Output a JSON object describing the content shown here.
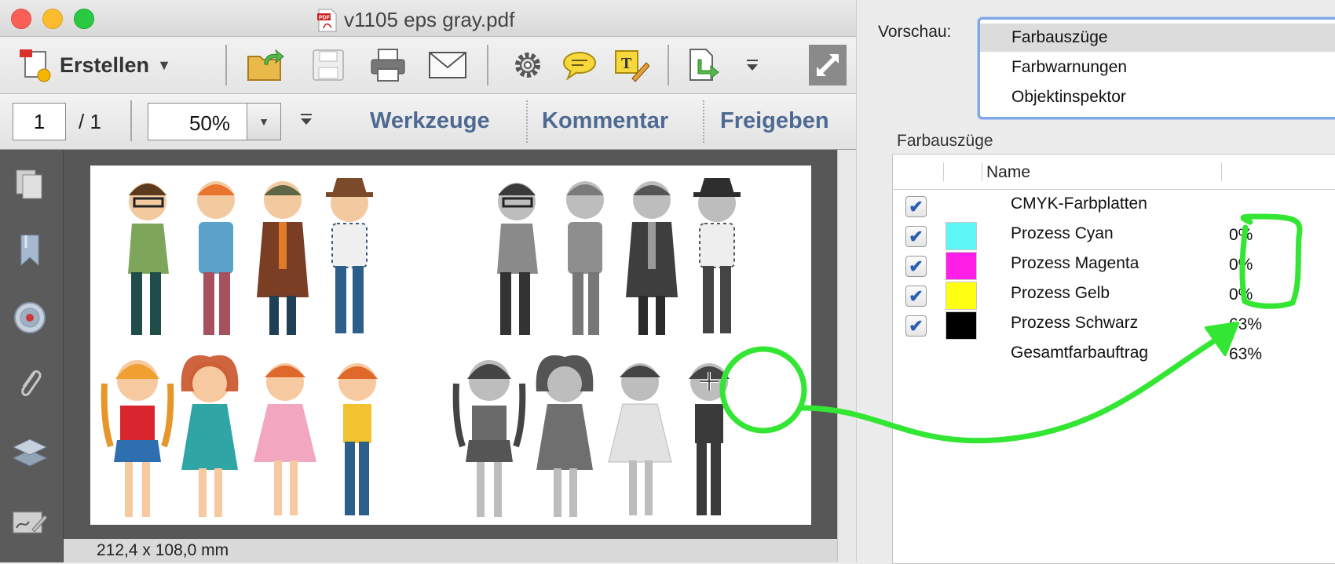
{
  "window": {
    "title": "v1105 eps gray.pdf"
  },
  "toolbar": {
    "create_label": "Erstellen",
    "icons": [
      "create-icon",
      "open-icon",
      "save-icon",
      "print-icon",
      "email-icon",
      "settings-icon",
      "comment-icon",
      "text-edit-icon",
      "export-icon",
      "more-icon",
      "expand-icon"
    ]
  },
  "navbar": {
    "page_current": "1",
    "page_total": "/ 1",
    "zoom": "50%",
    "tools": "Werkzeuge",
    "comment": "Kommentar",
    "share": "Freigeben"
  },
  "status": {
    "page_size": "212,4 x 108,0 mm"
  },
  "preview": {
    "label": "Vorschau:",
    "options": [
      "Farbauszüge",
      "Farbwarnungen",
      "Objektinspektor"
    ],
    "selected": "Farbauszüge"
  },
  "separations": {
    "heading": "Farbauszüge",
    "column_name": "Name",
    "rows": [
      {
        "name": "CMYK-Farbplatten",
        "checked": true,
        "swatch": null,
        "value": ""
      },
      {
        "name": "Prozess Cyan",
        "checked": true,
        "swatch": "#5ef7f7",
        "value": "0%"
      },
      {
        "name": "Prozess Magenta",
        "checked": true,
        "swatch": "#ff1ee6",
        "value": "0%"
      },
      {
        "name": "Prozess Gelb",
        "checked": true,
        "swatch": "#ffff14",
        "value": "0%"
      },
      {
        "name": "Prozess Schwarz",
        "checked": true,
        "swatch": "#000000",
        "value": "63%"
      },
      {
        "name": "Gesamtfarbauftrag",
        "checked": false,
        "swatch": null,
        "value": "63%"
      }
    ]
  },
  "colors": {
    "annotation_green": "#33e633",
    "link_blue": "#4e6a93",
    "focus_blue": "#7fa6e6"
  }
}
